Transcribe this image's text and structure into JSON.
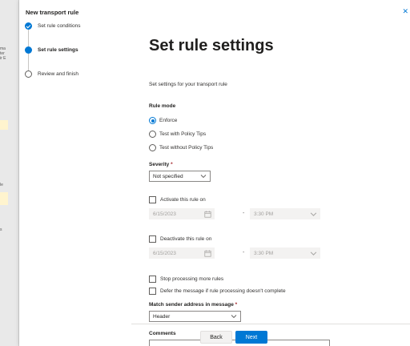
{
  "background": {
    "fragments": [
      "ma",
      "ter",
      "ir E",
      "le",
      "s"
    ]
  },
  "panel": {
    "title": "New transport rule",
    "close_icon": "close-icon"
  },
  "steps": [
    {
      "label": "Set rule conditions",
      "state": "done"
    },
    {
      "label": "Set rule settings",
      "state": "current"
    },
    {
      "label": "Review and finish",
      "state": "todo"
    }
  ],
  "content": {
    "heading": "Set rule settings",
    "subtext": "Set settings for your transport rule",
    "rule_mode": {
      "label": "Rule mode",
      "options": [
        "Enforce",
        "Test with Policy Tips",
        "Test without Policy Tips"
      ],
      "selected": "Enforce"
    },
    "severity": {
      "label": "Severity",
      "required_mark": "*",
      "value": "Not specified"
    },
    "activate": {
      "label": "Activate this rule on",
      "date": "6/15/2023",
      "dash": "-",
      "time": "3:30 PM"
    },
    "deactivate": {
      "label": "Deactivate this rule on",
      "date": "6/15/2023",
      "dash": "-",
      "time": "3:30 PM"
    },
    "stop_processing": "Stop processing more rules",
    "defer_message": "Defer the message if rule processing doesn't complete",
    "match_sender": {
      "label": "Match sender address in message",
      "required_mark": "*",
      "value": "Header"
    },
    "comments_label": "Comments"
  },
  "footer": {
    "back_label": "Back",
    "next_label": "Next"
  },
  "colors": {
    "accent": "#0078d4",
    "required": "#a4262c"
  }
}
